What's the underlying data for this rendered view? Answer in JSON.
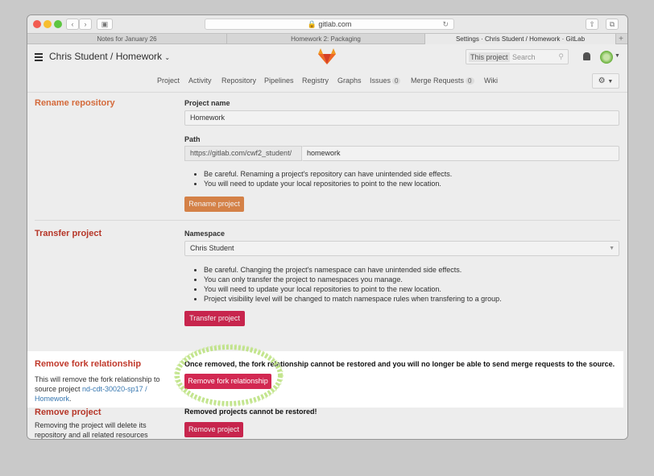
{
  "browser": {
    "url": "gitlab.com",
    "tabs": [
      {
        "label": "Notes for January 26"
      },
      {
        "label": "Homework 2: Packaging"
      },
      {
        "label": "Settings · Chris Student / Homework · GitLab"
      }
    ]
  },
  "header": {
    "project_title": "Chris Student / Homework",
    "search_scope": "This project",
    "search_placeholder": "Search"
  },
  "subnav": {
    "items": [
      "Project",
      "Activity",
      "Repository",
      "Pipelines",
      "Registry",
      "Graphs",
      "Issues",
      "Merge Requests",
      "Wiki"
    ],
    "issues_count": "0",
    "merge_requests_count": "0"
  },
  "rename": {
    "title": "Rename repository",
    "project_name_label": "Project name",
    "project_name_value": "Homework",
    "path_label": "Path",
    "path_prefix": "https://gitlab.com/cwf2_student/",
    "path_value": "homework",
    "notes": [
      "Be careful. Renaming a project's repository can have unintended side effects.",
      "You will need to update your local repositories to point to the new location."
    ],
    "button": "Rename project"
  },
  "transfer": {
    "title": "Transfer project",
    "namespace_label": "Namespace",
    "namespace_value": "Chris Student",
    "notes": [
      "Be careful. Changing the project's namespace can have unintended side effects.",
      "You can only transfer the project to namespaces you manage.",
      "You will need to update your local repositories to point to the new location.",
      "Project visibility level will be changed to match namespace rules when transfering to a group."
    ],
    "button": "Transfer project"
  },
  "fork": {
    "title": "Remove fork relationship",
    "desc_prefix": "This will remove the fork relationship to source project ",
    "desc_link": "nd-cdt-30020-sp17 / Homework",
    "desc_suffix": ".",
    "warning": "Once removed, the fork relationship cannot be restored and you will no longer be able to send merge requests to the source.",
    "button": "Remove fork relationship"
  },
  "remove": {
    "title": "Remove project",
    "desc": "Removing the project will delete its repository and all related resources",
    "warning": "Removed projects cannot be restored!",
    "button": "Remove project"
  },
  "colors": {
    "danger": "#d22852",
    "warning_orange": "#e0884b",
    "highlight_circle": "#b8e07a"
  }
}
